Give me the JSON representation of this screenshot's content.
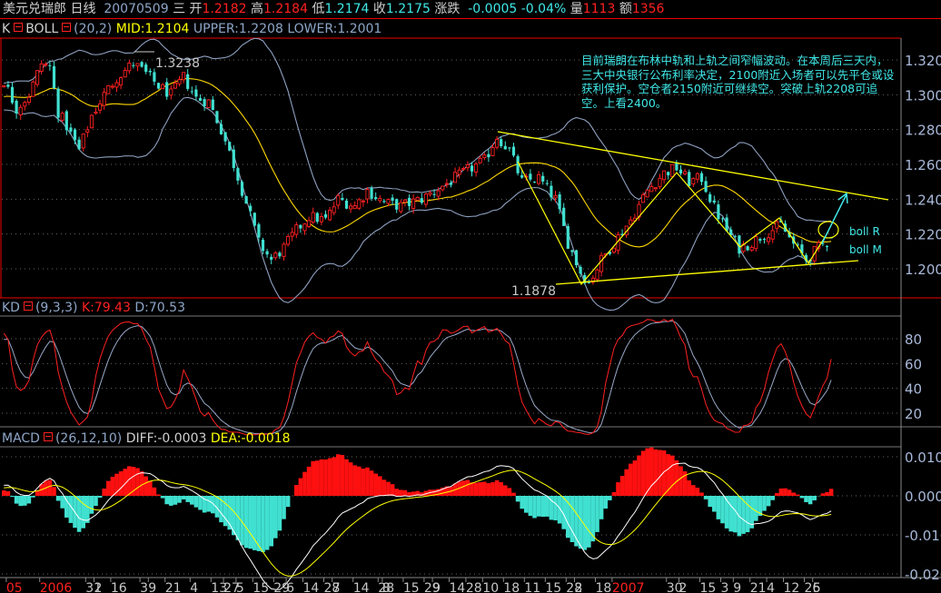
{
  "header": {
    "symbol": "美元兑瑞郎",
    "period": "日线",
    "date": "20070509",
    "weekday": "三",
    "open_label": "开",
    "open": "1.2182",
    "high_label": "高",
    "high": "1.2184",
    "low_label": "低",
    "low": "1.2174",
    "close_label": "收",
    "close": "1.2175",
    "change_label": "涨跌",
    "change": "-0.0005",
    "change_pct": "-0.04%",
    "volume_label": "量",
    "volume": "1113",
    "amount_label": "额",
    "amount": "1356"
  },
  "main_panel": {
    "prefix": "K",
    "indicator": "BOLL",
    "params": "(20,2)",
    "mid": "MID:1.2104",
    "upper": "UPPER:1.2208",
    "lower": "LOWER:1.2001",
    "high_mark": "1.3238",
    "low_mark": "1.1878",
    "annotation": "目前瑞朗在布林中轨和上轨之间窄幅波动。在本周后三天内，三大中央银行公布利率决定，2100附近入场者可以先平仓或设获利保护。空仓者2150附近可继续空。突破上轨2208可追空。上看2400。",
    "label_boll_r": "boll R",
    "label_boll_m": "boll M"
  },
  "kd_panel": {
    "indicator": "KD",
    "params": "(9,3,3)",
    "k": "K:79.43",
    "d": "D:70.53"
  },
  "macd_panel": {
    "indicator": "MACD",
    "params": "(26,12,10)",
    "diff": "DIFF:-0.0003",
    "dea": "DEA:-0.0018"
  },
  "colors": {
    "up": "#ff2020",
    "down": "#40e0d0",
    "mid": "#ffd800",
    "band": "#8ea0c0",
    "k": "#ff2020",
    "d": "#9aa8c8",
    "diff": "#ffffff",
    "dea": "#ffff00"
  },
  "chart_data": [
    {
      "type": "candlestick",
      "title": "美元兑瑞郎 日线",
      "candles": 199,
      "close_keypoints": [
        [
          -40,
          1.285
        ],
        [
          -25,
          1.3
        ],
        [
          -10,
          1.295
        ],
        [
          0,
          1.308
        ],
        [
          3,
          1.292
        ],
        [
          6,
          1.3
        ],
        [
          9,
          1.318
        ],
        [
          11,
          1.316
        ],
        [
          13,
          1.29
        ],
        [
          15,
          1.282
        ],
        [
          18,
          1.268
        ],
        [
          21,
          1.288
        ],
        [
          24,
          1.3
        ],
        [
          27,
          1.31
        ],
        [
          31,
          1.318
        ],
        [
          34,
          1.312
        ],
        [
          37,
          1.305
        ],
        [
          40,
          1.3
        ],
        [
          43,
          1.31
        ],
        [
          46,
          1.298
        ],
        [
          49,
          1.296
        ],
        [
          52,
          1.28
        ],
        [
          55,
          1.26
        ],
        [
          58,
          1.238
        ],
        [
          61,
          1.215
        ],
        [
          64,
          1.205
        ],
        [
          67,
          1.212
        ],
        [
          70,
          1.222
        ],
        [
          73,
          1.23
        ],
        [
          77,
          1.228
        ],
        [
          80,
          1.24
        ],
        [
          84,
          1.236
        ],
        [
          87,
          1.245
        ],
        [
          91,
          1.238
        ],
        [
          95,
          1.236
        ],
        [
          100,
          1.24
        ],
        [
          104,
          1.246
        ],
        [
          108,
          1.252
        ],
        [
          112,
          1.258
        ],
        [
          115,
          1.262
        ],
        [
          118,
          1.276
        ],
        [
          121,
          1.268
        ],
        [
          124,
          1.25
        ],
        [
          128,
          1.252
        ],
        [
          132,
          1.24
        ],
        [
          135,
          1.215
        ],
        [
          138,
          1.198
        ],
        [
          140,
          1.192
        ],
        [
          143,
          1.205
        ],
        [
          146,
          1.215
        ],
        [
          150,
          1.228
        ],
        [
          154,
          1.245
        ],
        [
          158,
          1.255
        ],
        [
          161,
          1.258
        ],
        [
          164,
          1.25
        ],
        [
          167,
          1.252
        ],
        [
          170,
          1.235
        ],
        [
          173,
          1.222
        ],
        [
          176,
          1.212
        ],
        [
          179,
          1.215
        ],
        [
          182,
          1.22
        ],
        [
          186,
          1.225
        ],
        [
          189,
          1.214
        ],
        [
          192,
          1.205
        ],
        [
          195,
          1.212
        ],
        [
          198,
          1.2175
        ]
      ],
      "last_candle": {
        "open": 1.2182,
        "high": 1.2184,
        "low": 1.2174,
        "close": 1.2175
      },
      "y_ticks": [
        "1.200",
        "1.220",
        "1.240",
        "1.260",
        "1.280",
        "1.300",
        "1.320"
      ],
      "ylim": [
        1.1838,
        1.3325
      ],
      "x_ticks": [
        {
          "i": 1,
          "t": "05",
          "red": true
        },
        {
          "i": 9,
          "t": "2006",
          "red": true
        },
        {
          "i": 20,
          "t": "31"
        },
        {
          "i": 22,
          "t": "2"
        },
        {
          "i": 26,
          "t": "16"
        },
        {
          "i": 33,
          "t": "3"
        },
        {
          "i": 35,
          "t": "9"
        },
        {
          "i": 39,
          "t": "21"
        },
        {
          "i": 45,
          "t": "4"
        },
        {
          "i": 50,
          "t": "13"
        },
        {
          "i": 53,
          "t": "27"
        },
        {
          "i": 56,
          "t": "5"
        },
        {
          "i": 60,
          "t": "15"
        },
        {
          "i": 65,
          "t": "29"
        },
        {
          "i": 68,
          "t": "6"
        },
        {
          "i": 72,
          "t": "14"
        },
        {
          "i": 77,
          "t": "28"
        },
        {
          "i": 79,
          "t": "7"
        },
        {
          "i": 84,
          "t": "14"
        },
        {
          "i": 90,
          "t": "28"
        },
        {
          "i": 91,
          "t": "8"
        },
        {
          "i": 96,
          "t": "15"
        },
        {
          "i": 101,
          "t": "29"
        },
        {
          "i": 103,
          "t": "9"
        },
        {
          "i": 107,
          "t": "14"
        },
        {
          "i": 111,
          "t": "28"
        },
        {
          "i": 115,
          "t": "10"
        },
        {
          "i": 120,
          "t": "18"
        },
        {
          "i": 125,
          "t": "11"
        },
        {
          "i": 130,
          "t": "15"
        },
        {
          "i": 135,
          "t": "28"
        },
        {
          "i": 137,
          "t": "2"
        },
        {
          "i": 142,
          "t": "18"
        },
        {
          "i": 146,
          "t": "2007",
          "red": true
        },
        {
          "i": 159,
          "t": "30"
        },
        {
          "i": 162,
          "t": "2"
        },
        {
          "i": 167,
          "t": "15"
        },
        {
          "i": 172,
          "t": "3"
        },
        {
          "i": 175,
          "t": "9"
        },
        {
          "i": 179,
          "t": "21"
        },
        {
          "i": 183,
          "t": "4"
        },
        {
          "i": 187,
          "t": "12"
        },
        {
          "i": 192,
          "t": "26"
        },
        {
          "i": 194,
          "t": "5"
        }
      ]
    },
    {
      "type": "line",
      "title": "KD(9,3,3)",
      "y_ticks": [
        "20",
        "40",
        "60",
        "80"
      ],
      "ylim": [
        0,
        100
      ],
      "last": {
        "K": 79.43,
        "D": 70.53
      }
    },
    {
      "type": "bar",
      "title": "MACD(26,12,10)",
      "y_ticks": [
        "0.010",
        "0.000",
        "-0.010",
        "-0.020"
      ],
      "ylim": [
        -0.021,
        0.0105
      ],
      "last": {
        "DIFF": -0.0003,
        "DEA": -0.0018
      }
    }
  ]
}
